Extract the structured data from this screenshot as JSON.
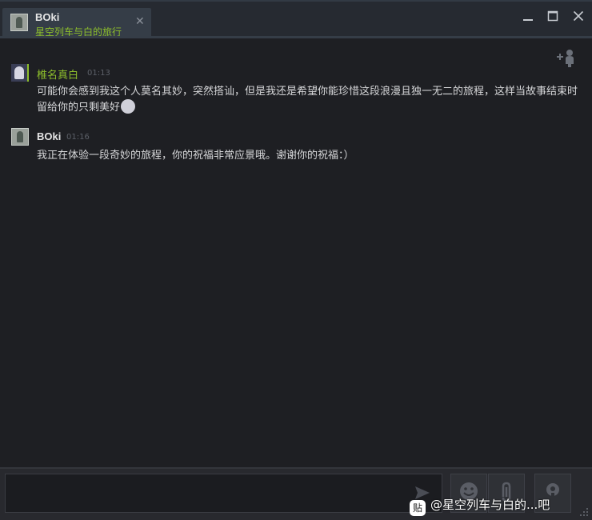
{
  "window": {
    "tab": {
      "name": "BOki",
      "status": "星空列车与白的旅行",
      "close_label": "✕"
    }
  },
  "messages": [
    {
      "sender": "椎名真白",
      "time": "01:13",
      "text": "可能你会感到我这个人莫名其妙，突然搭讪，但是我还是希望你能珍惜这段浪漫且独一无二的旅程，这样当故事结束时留给你的只剩美好",
      "has_emoji": true
    },
    {
      "sender": "BOki",
      "time": "01:16",
      "text": "我正在体验一段奇妙的旅程，你的祝福非常应景哦。谢谢你的祝福：）"
    }
  ],
  "input": {
    "placeholder": ""
  },
  "watermark": {
    "logo": "贴",
    "text": "@星空列车与白的...吧"
  },
  "icons": {
    "minimize": "minimize-icon",
    "maximize": "maximize-icon",
    "close": "close-icon",
    "add_friend": "add-friend-icon",
    "send": "send-icon",
    "emoticon": "smiley-icon",
    "attach": "paperclip-icon",
    "voice": "microphone-icon"
  },
  "colors": {
    "background": "#1e1f23",
    "accent_online": "#8dbe2c",
    "text": "#d6d7d9"
  }
}
